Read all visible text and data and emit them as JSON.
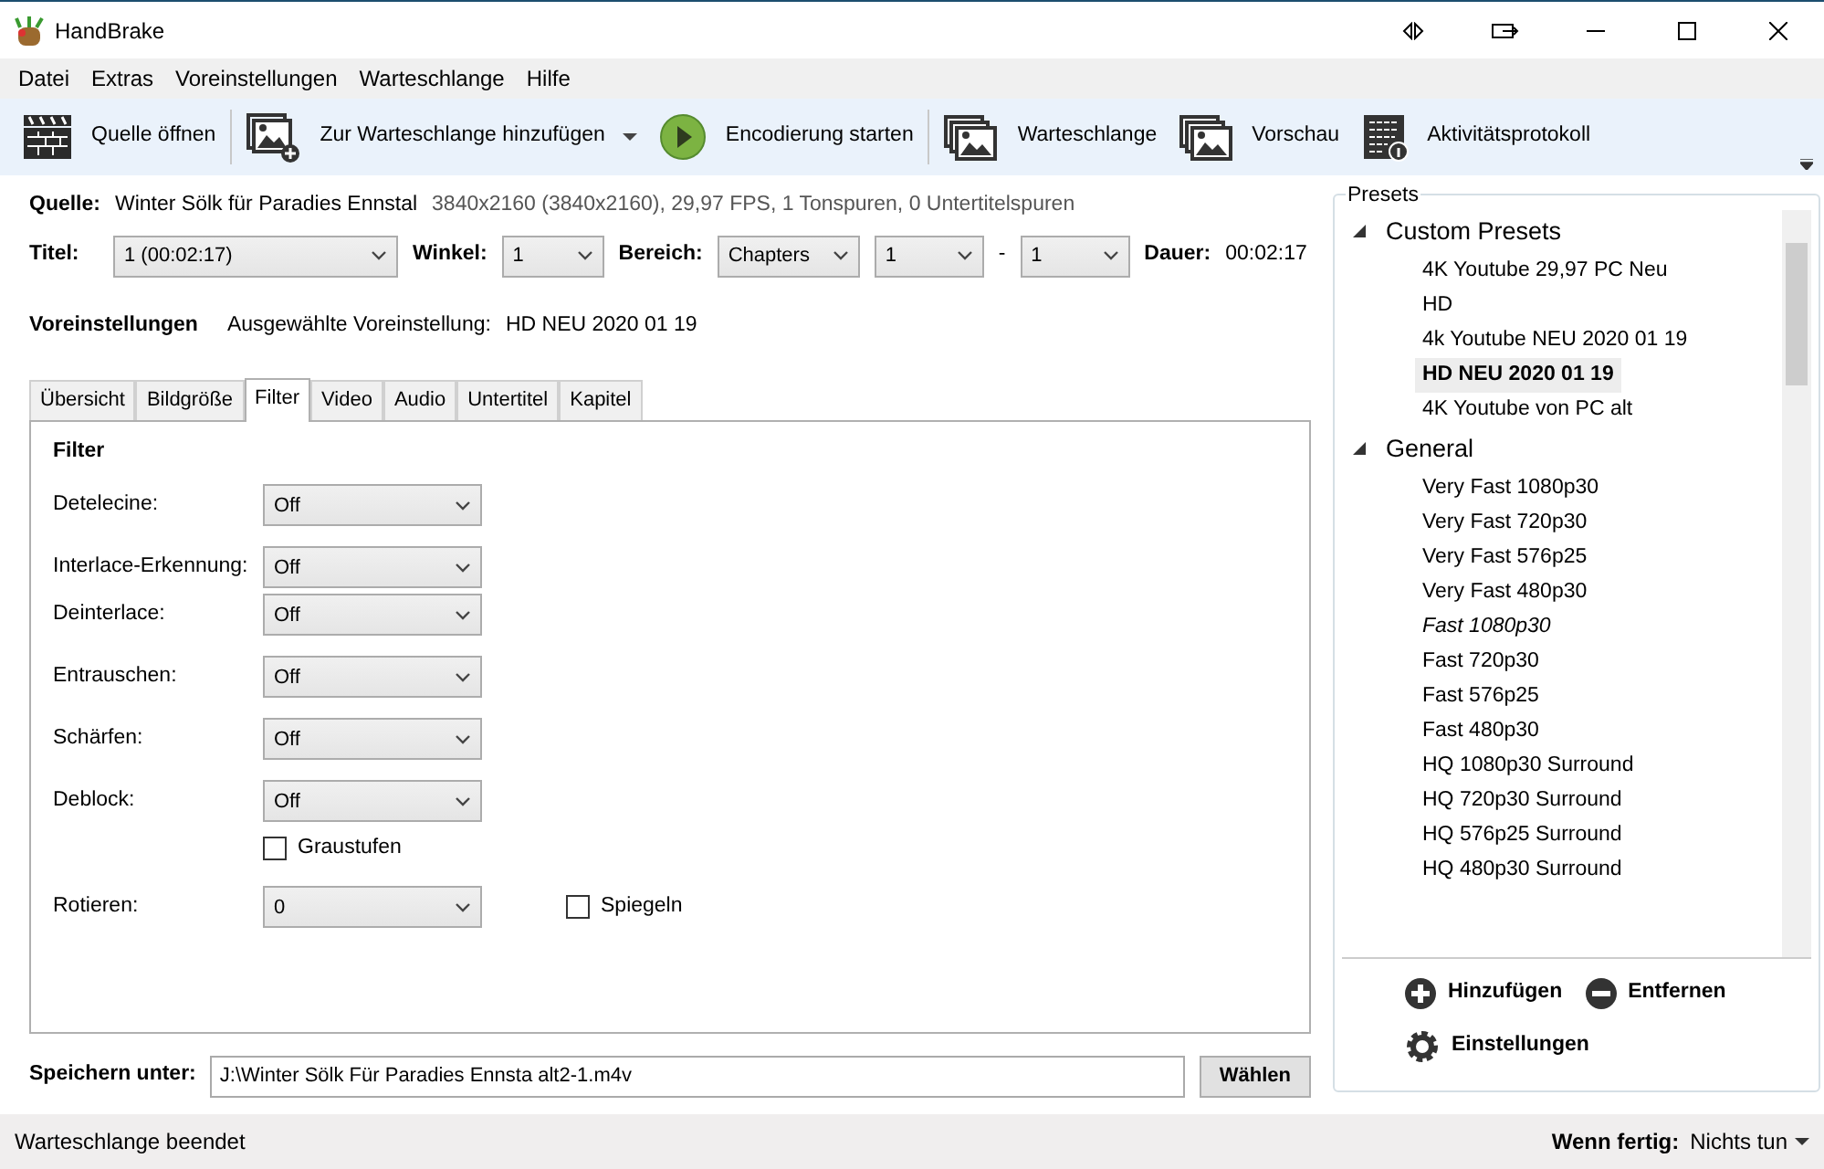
{
  "window": {
    "title": "HandBrake"
  },
  "menu": [
    "Datei",
    "Extras",
    "Voreinstellungen",
    "Warteschlange",
    "Hilfe"
  ],
  "toolbar": [
    {
      "kind": "clapper",
      "label": "Quelle öffnen"
    },
    {
      "kind": "add",
      "label": "Zur Warteschlange hinzufügen",
      "dropdown": true
    },
    {
      "kind": "play",
      "label": "Encodierung starten"
    },
    {
      "kind": "queue",
      "label": "Warteschlange"
    },
    {
      "kind": "queue",
      "label": "Vorschau"
    },
    {
      "kind": "log",
      "label": "Aktivitätsprotokoll"
    }
  ],
  "source": {
    "label": "Quelle:",
    "name": "Winter Sölk für Paradies Ennstal",
    "info": "3840x2160 (3840x2160), 29,97 FPS, 1 Tonspuren, 0 Untertitelspuren"
  },
  "title_row": {
    "title_label": "Titel:",
    "title_value": "1 (00:02:17)",
    "angle_label": "Winkel:",
    "angle_value": "1",
    "range_label": "Bereich:",
    "range_type": "Chapters",
    "range_from": "1",
    "range_dash": "-",
    "range_to": "1",
    "duration_label": "Dauer:",
    "duration": "00:02:17"
  },
  "preset_row": {
    "label": "Voreinstellungen",
    "text": "Ausgewählte Voreinstellung:",
    "value": "HD NEU 2020 01 19"
  },
  "tabs": [
    {
      "label": "Übersicht",
      "selected": false
    },
    {
      "label": "Bildgröße",
      "selected": false
    },
    {
      "label": "Filter",
      "selected": true
    },
    {
      "label": "Video",
      "selected": false
    },
    {
      "label": "Audio",
      "selected": false
    },
    {
      "label": "Untertitel",
      "selected": false
    },
    {
      "label": "Kapitel",
      "selected": false
    }
  ],
  "filter": {
    "heading": "Filter",
    "items": [
      {
        "kind": "select",
        "label": "Detelecine:",
        "value": "Off"
      },
      {
        "kind": "gap"
      },
      {
        "kind": "select",
        "label": "Interlace-Erkennung:",
        "value": "Off"
      },
      {
        "kind": "select",
        "label": "Deinterlace:",
        "value": "Off"
      },
      {
        "kind": "gap"
      },
      {
        "kind": "select",
        "label": "Entrauschen:",
        "value": "Off"
      },
      {
        "kind": "gap"
      },
      {
        "kind": "select",
        "label": "Schärfen:",
        "value": "Off"
      },
      {
        "kind": "gap"
      },
      {
        "kind": "select",
        "label": "Deblock:",
        "value": "Off"
      },
      {
        "kind": "checkbox",
        "label": "Graustufen",
        "checked": false
      },
      {
        "kind": "select_checkbox",
        "label": "Rotieren:",
        "value": "0",
        "checkbox": {
          "label": "Spiegeln",
          "checked": false
        }
      }
    ]
  },
  "save": {
    "label": "Speichern unter:",
    "value": "J:\\Winter Sölk Für Paradies Ennsta alt2-1.m4v",
    "button": "Wählen"
  },
  "presets": {
    "title": "Presets",
    "groups": [
      {
        "label": "Custom Presets",
        "expanded": true,
        "children": [
          {
            "label": "4K Youtube 29,97 PC Neu",
            "selected": false,
            "default": false
          },
          {
            "label": "HD",
            "selected": false,
            "default": false
          },
          {
            "label": "4k Youtube NEU 2020 01 19",
            "selected": false,
            "default": false
          },
          {
            "label": "HD NEU 2020 01 19",
            "selected": true,
            "default": false
          },
          {
            "label": "4K Youtube von PC alt",
            "selected": false,
            "default": false
          }
        ]
      },
      {
        "label": "General",
        "expanded": true,
        "children": [
          {
            "label": "Very Fast 1080p30",
            "selected": false,
            "default": false
          },
          {
            "label": "Very Fast 720p30",
            "selected": false,
            "default": false
          },
          {
            "label": "Very Fast 576p25",
            "selected": false,
            "default": false
          },
          {
            "label": "Very Fast 480p30",
            "selected": false,
            "default": false
          },
          {
            "label": "Fast 1080p30",
            "selected": false,
            "default": true
          },
          {
            "label": "Fast 720p30",
            "selected": false,
            "default": false
          },
          {
            "label": "Fast 576p25",
            "selected": false,
            "default": false
          },
          {
            "label": "Fast 480p30",
            "selected": false,
            "default": false
          },
          {
            "label": "HQ 1080p30 Surround",
            "selected": false,
            "default": false
          },
          {
            "label": "HQ 720p30 Surround",
            "selected": false,
            "default": false
          },
          {
            "label": "HQ 576p25 Surround",
            "selected": false,
            "default": false
          },
          {
            "label": "HQ 480p30 Surround",
            "selected": false,
            "default": false
          }
        ]
      }
    ],
    "buttons": [
      {
        "kind": "add",
        "label": "Hinzufügen"
      },
      {
        "kind": "remove",
        "label": "Entfernen"
      },
      {
        "kind": "settings",
        "label": "Einstellungen"
      }
    ]
  },
  "status_bar": {
    "text": "Warteschlange beendet",
    "when_done_label": "Wenn fertig:",
    "when_done_value": "Nichts tun"
  }
}
